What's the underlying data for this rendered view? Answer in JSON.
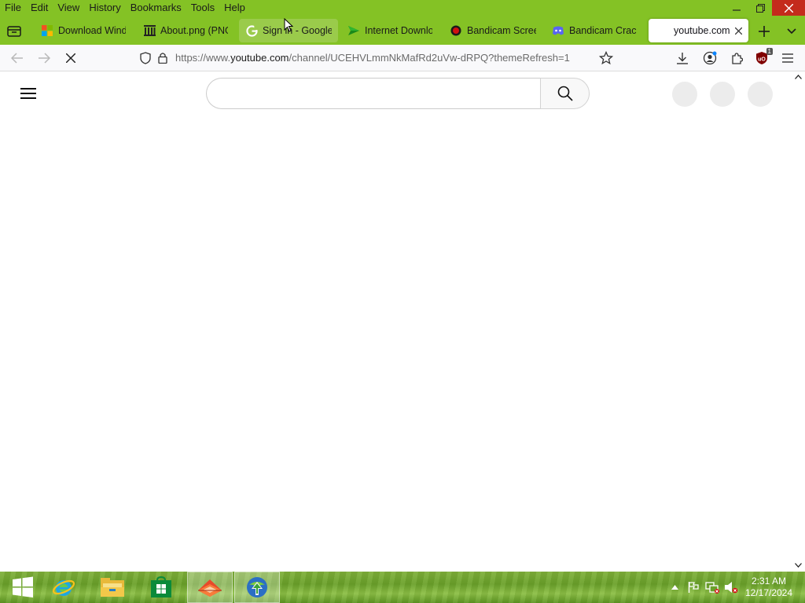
{
  "menubar": {
    "items": [
      "File",
      "Edit",
      "View",
      "History",
      "Bookmarks",
      "Tools",
      "Help"
    ],
    "bg_color": "#84c225"
  },
  "window_controls": {
    "minimize": "minimize-icon",
    "restore": "restore-icon",
    "close": "close-icon"
  },
  "tabs": [
    {
      "label": "Download Windo",
      "icon": "windows-logo-icon",
      "state": "normal"
    },
    {
      "label": "About.png (PNG",
      "icon": "wikimedia-icon",
      "state": "normal"
    },
    {
      "label": "Sign in - Google",
      "icon": "google-icon",
      "state": "hovered"
    },
    {
      "label": "Internet Downlo",
      "icon": "idm-icon",
      "state": "normal"
    },
    {
      "label": "Bandicam Scree",
      "icon": "bandicam-icon",
      "state": "normal"
    },
    {
      "label": "Bandicam Crack",
      "icon": "discord-icon",
      "state": "normal"
    },
    {
      "label": "youtube.com",
      "icon": "",
      "state": "active"
    }
  ],
  "navbar": {
    "url_prefix": "https://www.",
    "url_host": "youtube.com",
    "url_rest": "/channel/UCEHVLmmNkMafRd2uVw-dRPQ?themeRefresh=1",
    "extension_badge": "1"
  },
  "page": {
    "search_placeholder": ""
  },
  "taskbar": {
    "apps": [
      "start-icon",
      "internet-explorer-icon",
      "file-explorer-icon",
      "store-icon",
      "firefox-icon",
      "idm-icon"
    ],
    "clock_time": "2:31 AM",
    "clock_date": "12/17/2024"
  }
}
